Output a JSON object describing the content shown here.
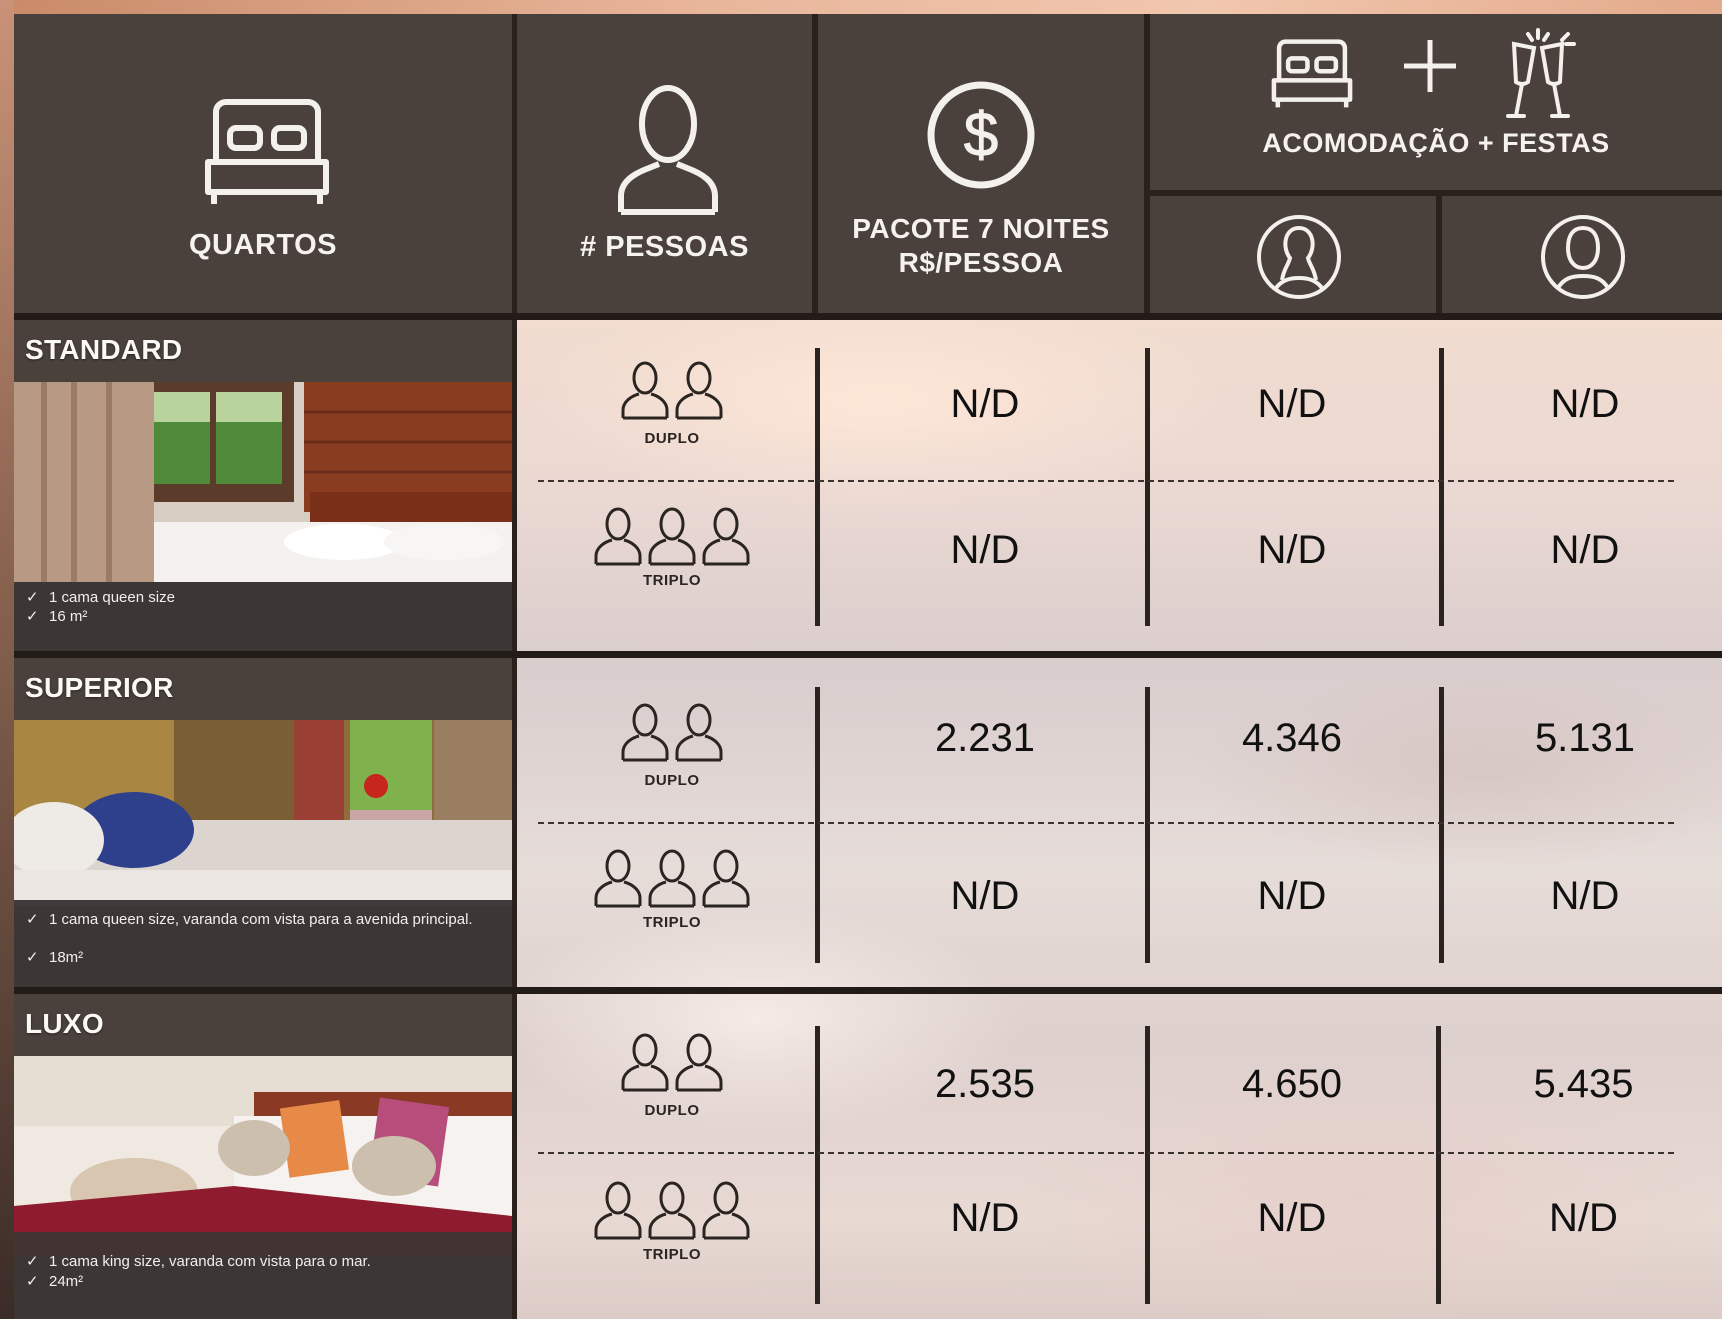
{
  "header": {
    "quartos_label": "QUARTOS",
    "pessoas_label": "# PESSOAS",
    "pacote_line1": "PACOTE 7 NOITES",
    "pacote_line2": "R$/PESSOA",
    "combo_label": "ACOMODAÇÃO + FESTAS",
    "icons": [
      "bed-icon",
      "person-icon",
      "dollar-icon",
      "bed-icon",
      "plus-icon",
      "champagne-icon",
      "female-icon",
      "male-icon"
    ]
  },
  "rooms": [
    {
      "name": "STANDARD",
      "features": [
        "1 cama queen size",
        "16 m²"
      ],
      "rows": [
        {
          "occupancy": "DUPLO",
          "pacote": "N/D",
          "combo_female": "N/D",
          "combo_male": "N/D"
        },
        {
          "occupancy": "TRIPLO",
          "pacote": "N/D",
          "combo_female": "N/D",
          "combo_male": "N/D"
        }
      ]
    },
    {
      "name": "SUPERIOR",
      "features": [
        "1 cama queen size, varanda com vista para a avenida principal.",
        "18m²"
      ],
      "rows": [
        {
          "occupancy": "DUPLO",
          "pacote": "2.231",
          "combo_female": "4.346",
          "combo_male": "5.131"
        },
        {
          "occupancy": "TRIPLO",
          "pacote": "N/D",
          "combo_female": "N/D",
          "combo_male": "N/D"
        }
      ]
    },
    {
      "name": "LUXO",
      "features": [
        "1 cama king size, varanda com vista para o mar.",
        "24m²"
      ],
      "rows": [
        {
          "occupancy": "DUPLO",
          "pacote": "2.535",
          "combo_female": "4.650",
          "combo_male": "5.435"
        },
        {
          "occupancy": "TRIPLO",
          "pacote": "N/D",
          "combo_female": "N/D",
          "combo_male": "N/D"
        }
      ]
    }
  ]
}
